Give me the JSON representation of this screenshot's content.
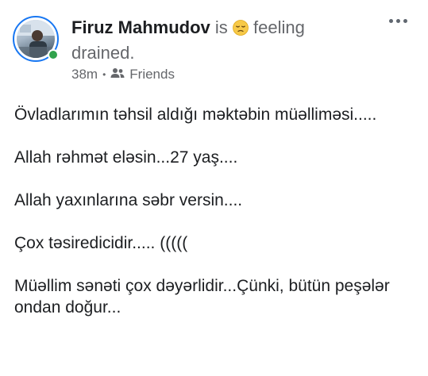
{
  "post": {
    "author": "Firuz Mahmudov",
    "is_text": "is",
    "feeling_icon": "drained-face-emoji",
    "feeling_text": "feeling drained.",
    "time": "38m",
    "separator": "•",
    "audience_icon": "friends-icon",
    "audience": "Friends",
    "more_icon": "more-options-icon",
    "paragraphs": [
      "Övladlarımın təhsil aldığı məktəbin müəllimәsi.....",
      "Allah rəhmət eləsin...27 yaş....",
      "Allah yaxınlarına səbr versin....",
      "Çox təsiredicidir..... (((((",
      "Müəllim sənəti çox dəyərlidir...Çünki, bütün peşələr ondan doğur..."
    ]
  },
  "colors": {
    "accent": "#1877f2",
    "online": "#31a24c",
    "secondary_text": "#65676b",
    "primary_text": "#1c1e21"
  }
}
